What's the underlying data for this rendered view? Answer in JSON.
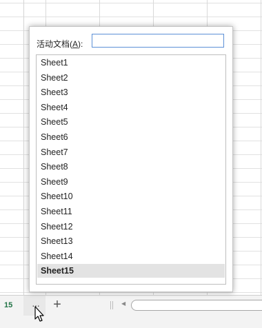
{
  "footer": {
    "row_number": "15",
    "more_sheets_icon": "ellipsis-icon",
    "more_sheets_glyph": "···",
    "add_sheet_glyph": "+",
    "scroll_left_glyph": "◀"
  },
  "dialog": {
    "label_prefix": "活动文档(",
    "label_accel": "A",
    "label_suffix": "):",
    "input_value": "",
    "items": [
      "Sheet1",
      "Sheet2",
      "Sheet3",
      "Sheet4",
      "Sheet5",
      "Sheet6",
      "Sheet7",
      "Sheet8",
      "Sheet9",
      "Sheet10",
      "Sheet11",
      "Sheet12",
      "Sheet13",
      "Sheet14",
      "Sheet15"
    ],
    "selected_item": "Sheet15"
  },
  "colors": {
    "row_number": "#217346",
    "input_border": "#5b8fd6",
    "selected_bg": "#e3e3e3"
  }
}
